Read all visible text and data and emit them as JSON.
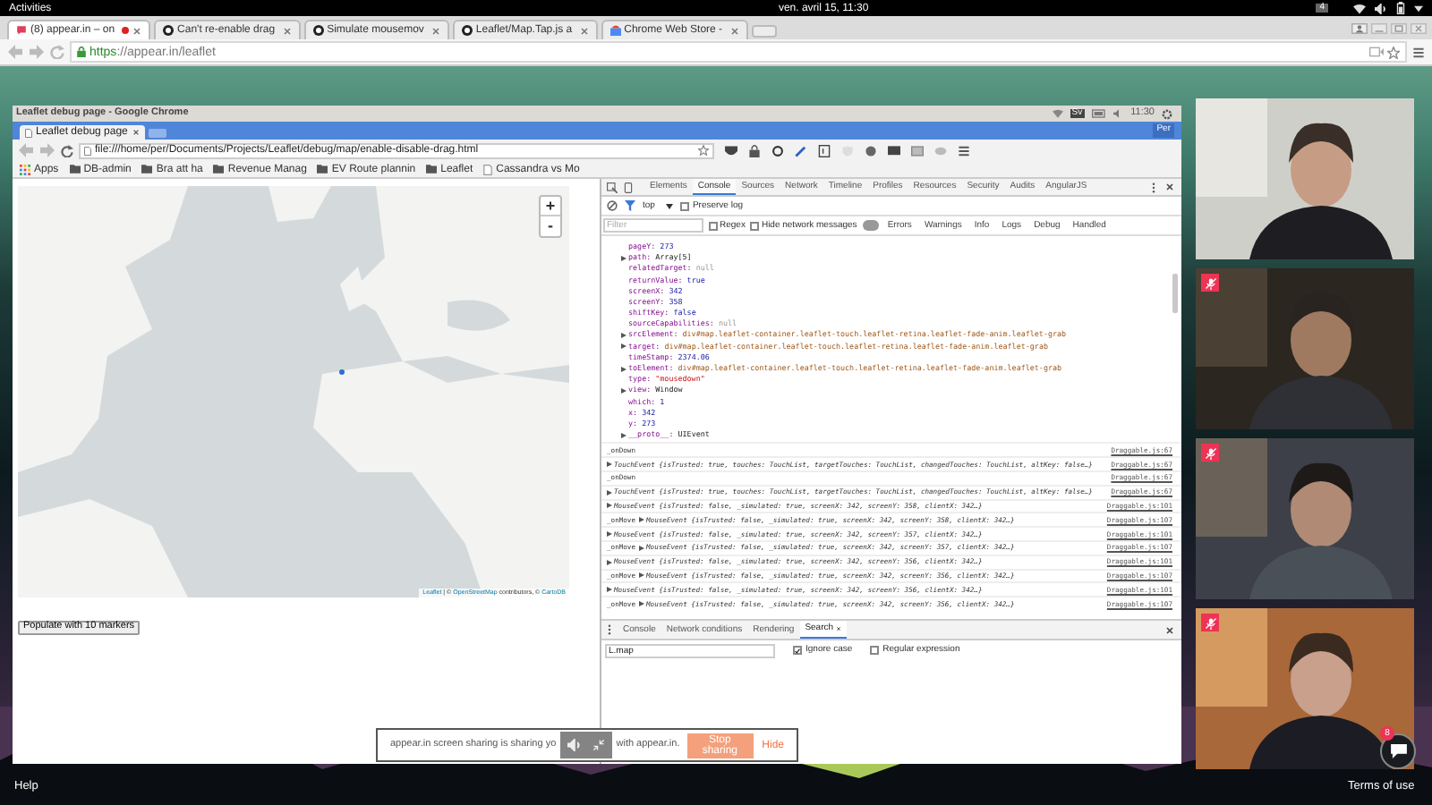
{
  "top_bar": {
    "activities": "Activities",
    "clock": "ven. avril 15, 11:30",
    "workspace": "4"
  },
  "browser": {
    "tabs": [
      {
        "title": "(8) appear.in – on",
        "selected": true,
        "recording": true,
        "kind": "appear"
      },
      {
        "title": "Can't re-enable drag",
        "selected": false,
        "recording": false,
        "kind": "github"
      },
      {
        "title": "Simulate mousemov",
        "selected": false,
        "recording": false,
        "kind": "github"
      },
      {
        "title": "Leaflet/Map.Tap.js a",
        "selected": false,
        "recording": false,
        "kind": "github"
      },
      {
        "title": "Chrome Web Store -",
        "selected": false,
        "recording": false,
        "kind": "store"
      }
    ],
    "url_scheme": "https",
    "url_rest": "://appear.in/leaflet"
  },
  "inner_window": {
    "title": "Leaflet debug page - Google Chrome",
    "keyboard": "Sv",
    "clock": "11:30",
    "tab": "Leaflet debug page",
    "profile": "Per",
    "url": "file:///home/per/Documents/Projects/Leaflet/debug/map/enable-disable-drag.html",
    "bookmarks": [
      {
        "label": "Apps",
        "kind": "apps"
      },
      {
        "label": "DB-admin",
        "kind": "folder"
      },
      {
        "label": "Bra att ha",
        "kind": "folder"
      },
      {
        "label": "Revenue Manag",
        "kind": "folder"
      },
      {
        "label": "EV Route plannin",
        "kind": "folder"
      },
      {
        "label": "Leaflet",
        "kind": "folder"
      },
      {
        "label": "Cassandra vs Mo",
        "kind": "page"
      }
    ]
  },
  "page": {
    "zoom_in": "+",
    "zoom_out": "-",
    "attribution": [
      {
        "text": "Leaflet",
        "link": true
      },
      {
        "text": " | © ",
        "link": false
      },
      {
        "text": "OpenStreetMap",
        "link": true
      },
      {
        "text": " contributors, © ",
        "link": false
      },
      {
        "text": "CartoDB",
        "link": true
      }
    ],
    "button": "Populate with 10 markers"
  },
  "devtools": {
    "tabs": [
      {
        "label": "Elements",
        "selected": false
      },
      {
        "label": "Console",
        "selected": true
      },
      {
        "label": "Sources",
        "selected": false
      },
      {
        "label": "Network",
        "selected": false
      },
      {
        "label": "Timeline",
        "selected": false
      },
      {
        "label": "Profiles",
        "selected": false
      },
      {
        "label": "Resources",
        "selected": false
      },
      {
        "label": "Security",
        "selected": false
      },
      {
        "label": "Audits",
        "selected": false
      },
      {
        "label": "AngularJS",
        "selected": false
      }
    ],
    "context": "top",
    "preserve_log": {
      "label": "Preserve log",
      "checked": false
    },
    "filter_placeholder": "Filter",
    "regex": {
      "label": "Regex",
      "checked": false
    },
    "hide_network": {
      "label": "Hide network messages",
      "checked": false
    },
    "levels": [
      "Errors",
      "Warnings",
      "Info",
      "Logs",
      "Debug",
      "Handled"
    ],
    "properties": [
      {
        "key": "pageY:",
        "value": "273",
        "kind": "number",
        "expandable": false
      },
      {
        "key": "path:",
        "value": "Array[5]",
        "kind": "object",
        "expandable": true
      },
      {
        "key": "relatedTarget:",
        "value": "null",
        "kind": "null",
        "expandable": false
      },
      {
        "key": "returnValue:",
        "value": "true",
        "kind": "number",
        "expandable": false
      },
      {
        "key": "screenX:",
        "value": "342",
        "kind": "number",
        "expandable": false
      },
      {
        "key": "screenY:",
        "value": "358",
        "kind": "number",
        "expandable": false
      },
      {
        "key": "shiftKey:",
        "value": "false",
        "kind": "number",
        "expandable": false
      },
      {
        "key": "sourceCapabilities:",
        "value": "null",
        "kind": "null",
        "expandable": false
      },
      {
        "key": "srcElement:",
        "value": "div#map.leaflet-container.leaflet-touch.leaflet-retina.leaflet-fade-anim.leaflet-grab",
        "kind": "element",
        "expandable": true
      },
      {
        "key": "target:",
        "value": "div#map.leaflet-container.leaflet-touch.leaflet-retina.leaflet-fade-anim.leaflet-grab",
        "kind": "element",
        "expandable": true
      },
      {
        "key": "timeStamp:",
        "value": "2374.06",
        "kind": "number",
        "expandable": false
      },
      {
        "key": "toElement:",
        "value": "div#map.leaflet-container.leaflet-touch.leaflet-retina.leaflet-fade-anim.leaflet-grab",
        "kind": "element",
        "expandable": true
      },
      {
        "key": "type:",
        "value": "\"mousedown\"",
        "kind": "string",
        "expandable": false
      },
      {
        "key": "view:",
        "value": "Window",
        "kind": "object",
        "expandable": true
      },
      {
        "key": "which:",
        "value": "1",
        "kind": "number",
        "expandable": false
      },
      {
        "key": "x:",
        "value": "342",
        "kind": "number",
        "expandable": false
      },
      {
        "key": "y:",
        "value": "273",
        "kind": "number",
        "expandable": false
      },
      {
        "key": "__proto__:",
        "value": "UIEvent",
        "kind": "object",
        "expandable": true
      }
    ],
    "log": [
      {
        "label": "_onDown",
        "source": "Draggable.js:67"
      },
      {
        "message": "TouchEvent {isTrusted: true, touches: TouchList, targetTouches: TouchList, changedTouches: TouchList, altKey: false…}",
        "source": "Draggable.js:67"
      },
      {
        "label": "_onDown",
        "source": "Draggable.js:67"
      },
      {
        "message": "TouchEvent {isTrusted: true, touches: TouchList, targetTouches: TouchList, changedTouches: TouchList, altKey: false…}",
        "source": "Draggable.js:67"
      },
      {
        "message": "MouseEvent {isTrusted: false, _simulated: true, screenX: 342, screenY: 358, clientX: 342…}",
        "source": "Draggable.js:101"
      },
      {
        "label": "_onMove",
        "message": "MouseEvent {isTrusted: false, _simulated: true, screenX: 342, screenY: 358, clientX: 342…}",
        "source": "Draggable.js:107"
      },
      {
        "message": "MouseEvent {isTrusted: false, _simulated: true, screenX: 342, screenY: 357, clientX: 342…}",
        "source": "Draggable.js:101"
      },
      {
        "label": "_onMove",
        "message": "MouseEvent {isTrusted: false, _simulated: true, screenX: 342, screenY: 357, clientX: 342…}",
        "source": "Draggable.js:107"
      },
      {
        "message": "MouseEvent {isTrusted: false, _simulated: true, screenX: 342, screenY: 356, clientX: 342…}",
        "source": "Draggable.js:101"
      },
      {
        "label": "_onMove",
        "message": "MouseEvent {isTrusted: false, _simulated: true, screenX: 342, screenY: 356, clientX: 342…}",
        "source": "Draggable.js:107"
      },
      {
        "message": "MouseEvent {isTrusted: false, _simulated: true, screenX: 342, screenY: 356, clientX: 342…}",
        "source": "Draggable.js:101"
      },
      {
        "label": "_onMove",
        "message": "MouseEvent {isTrusted: false, _simulated: true, screenX: 342, screenY: 356, clientX: 342…}",
        "source": "Draggable.js:107"
      }
    ],
    "drawer": {
      "tabs": [
        {
          "label": "Console",
          "selected": false,
          "closable": false
        },
        {
          "label": "Network conditions",
          "selected": false,
          "closable": false
        },
        {
          "label": "Rendering",
          "selected": false,
          "closable": false
        },
        {
          "label": "Search",
          "selected": true,
          "closable": true
        }
      ],
      "query": "L.map",
      "ignore_case": {
        "label": "Ignore case",
        "checked": true
      },
      "regex": {
        "label": "Regular expression",
        "checked": false
      }
    }
  },
  "videos": [
    {
      "muted": false,
      "kind": "light"
    },
    {
      "muted": true,
      "kind": "dark"
    },
    {
      "muted": true,
      "kind": "dim"
    },
    {
      "muted": true,
      "kind": "wood"
    }
  ],
  "share_banner": {
    "text_before": "appear.in screen sharing is sharing yo",
    "text_after": "with appear.in.",
    "stop": "Stop sharing",
    "hide": "Hide"
  },
  "chat": {
    "badge": "8"
  },
  "footer": {
    "help": "Help",
    "terms": "Terms of use"
  }
}
